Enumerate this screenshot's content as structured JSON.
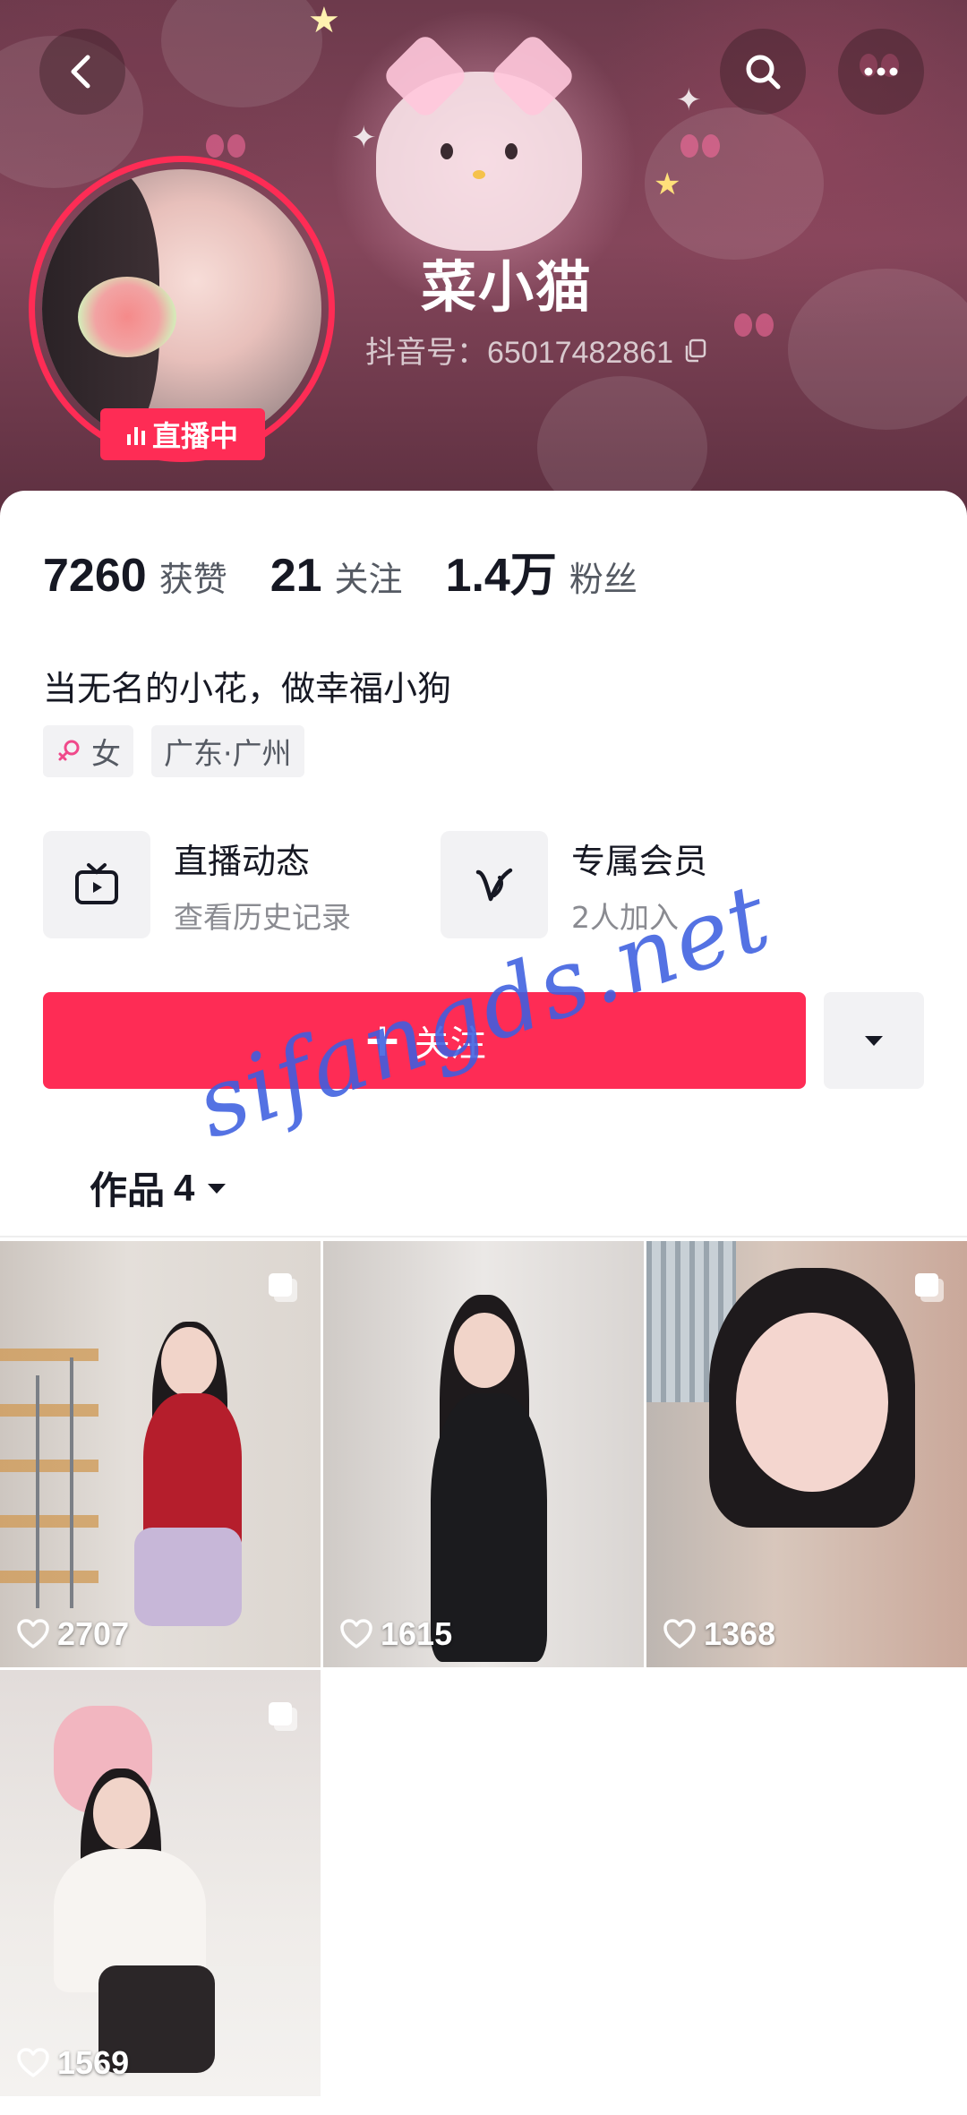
{
  "header": {
    "nickname": "菜小猫",
    "douyin_id": "抖音号：65017482861",
    "live_badge": "直播中"
  },
  "stats": [
    {
      "value": "7260",
      "label": "获赞"
    },
    {
      "value": "21",
      "label": "关注"
    },
    {
      "value": "1.4万",
      "label": "粉丝"
    }
  ],
  "bio": "当无名的小花，做幸福小狗",
  "tags": {
    "gender": "女",
    "location": "广东·广州"
  },
  "entries": [
    {
      "title": "直播动态",
      "subtitle": "查看历史记录",
      "icon": "tv-icon"
    },
    {
      "title": "专属会员",
      "subtitle": "2人加入",
      "icon": "v-icon"
    }
  ],
  "follow_label": "关注",
  "works_tab": {
    "label": "作品",
    "count": "4"
  },
  "posts": [
    {
      "likes": "2707"
    },
    {
      "likes": "1615"
    },
    {
      "likes": "1368"
    },
    {
      "likes": "1569"
    }
  ],
  "watermark": "sifangds.net",
  "colors": {
    "accent": "#fe2c55",
    "text": "#161823",
    "muted": "#8a8b91"
  }
}
